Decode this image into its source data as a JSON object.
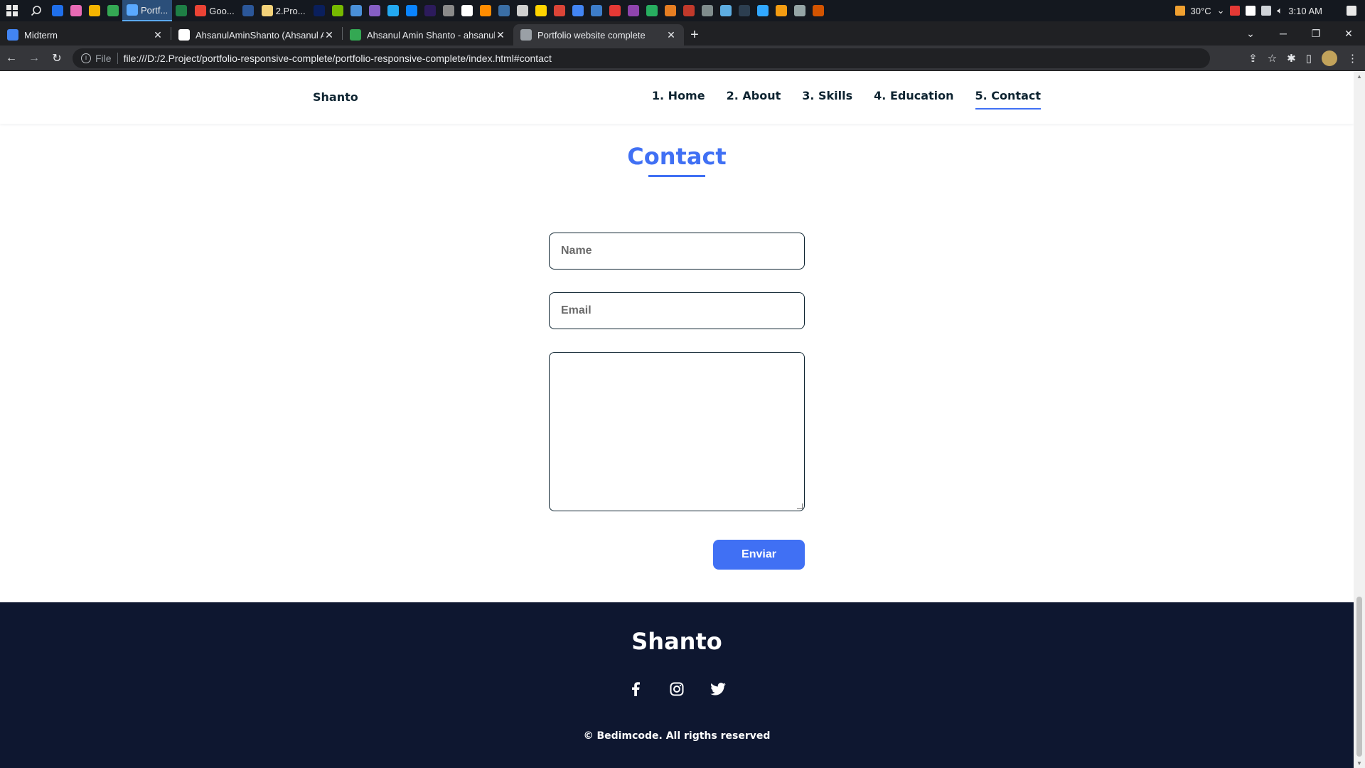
{
  "taskbar": {
    "apps": [
      {
        "label": "",
        "color": "#1f6feb"
      },
      {
        "label": "",
        "color": "#e86ab5"
      },
      {
        "label": "",
        "color": "#f4b400"
      },
      {
        "label": "",
        "color": "#34a853"
      },
      {
        "label": "Portf...",
        "color": "#5aa9ff",
        "active": true
      },
      {
        "label": "",
        "color": "#1e7e45"
      },
      {
        "label": "Goo...",
        "color": "#ea4335"
      },
      {
        "label": "",
        "color": "#2b579a"
      },
      {
        "label": "2.Pro...",
        "color": "#f3d27a"
      },
      {
        "label": "",
        "color": "#0a1f5c"
      },
      {
        "label": "",
        "color": "#76b900"
      },
      {
        "label": "",
        "color": "#4a90d9"
      },
      {
        "label": "",
        "color": "#865fc5"
      },
      {
        "label": "",
        "color": "#23a9f2"
      },
      {
        "label": "",
        "color": "#0a84ff"
      },
      {
        "label": "",
        "color": "#2c1b5c"
      },
      {
        "label": "",
        "color": "#8a8a8a"
      },
      {
        "label": "",
        "color": "#ffffff"
      },
      {
        "label": "",
        "color": "#ff8c00"
      },
      {
        "label": "",
        "color": "#3a6ea5"
      },
      {
        "label": "",
        "color": "#cfcfcf"
      },
      {
        "label": "",
        "color": "#ffd400"
      },
      {
        "label": "",
        "color": "#db4437"
      },
      {
        "label": "",
        "color": "#4285f4"
      },
      {
        "label": "",
        "color": "#3d7dca"
      },
      {
        "label": "",
        "color": "#e53935"
      },
      {
        "label": "",
        "color": "#8e44ad"
      },
      {
        "label": "",
        "color": "#27ae60"
      },
      {
        "label": "",
        "color": "#e67e22"
      },
      {
        "label": "",
        "color": "#c0392b"
      },
      {
        "label": "",
        "color": "#7f8c8d"
      },
      {
        "label": "",
        "color": "#5dade2"
      },
      {
        "label": "",
        "color": "#2c3e50"
      },
      {
        "label": "",
        "color": "#31a8ff"
      },
      {
        "label": "",
        "color": "#f39c12"
      },
      {
        "label": "",
        "color": "#95a5a6"
      },
      {
        "label": "",
        "color": "#d35400"
      }
    ],
    "temperature": "30°C",
    "time": "3:10 AM"
  },
  "browser": {
    "tabs": [
      {
        "title": "Midterm",
        "favicon_color": "#4285f4",
        "active": false
      },
      {
        "title": "AhsanulAminShanto (Ahsanul Am",
        "favicon_color": "#ffffff",
        "active": false
      },
      {
        "title": "Ahsanul Amin Shanto - ahsanula",
        "favicon_color": "#34a853",
        "active": false
      },
      {
        "title": "Portfolio website complete",
        "favicon_color": "#9aa0a6",
        "active": true
      }
    ],
    "file_label": "File",
    "url": "file:///D:/2.Project/portfolio-responsive-complete/portfolio-responsive-complete/index.html#contact"
  },
  "site": {
    "brand": "Shanto",
    "nav": [
      {
        "label": "1. Home",
        "active": false
      },
      {
        "label": "2. About",
        "active": false
      },
      {
        "label": "3. Skills",
        "active": false
      },
      {
        "label": "4. Education",
        "active": false
      },
      {
        "label": "5. Contact",
        "active": true
      }
    ],
    "section_title": "Contact",
    "form": {
      "name_placeholder": "Name",
      "email_placeholder": "Email",
      "message_placeholder": "",
      "submit_label": "Enviar"
    },
    "footer": {
      "brand": "Shanto",
      "socials": [
        "facebook-icon",
        "instagram-icon",
        "twitter-icon"
      ],
      "copyright": "© Bedimcode. All rigths reserved"
    },
    "colors": {
      "accent": "#4070f4",
      "text_dark": "#0e2431",
      "footer_bg": "#0e1730"
    }
  }
}
